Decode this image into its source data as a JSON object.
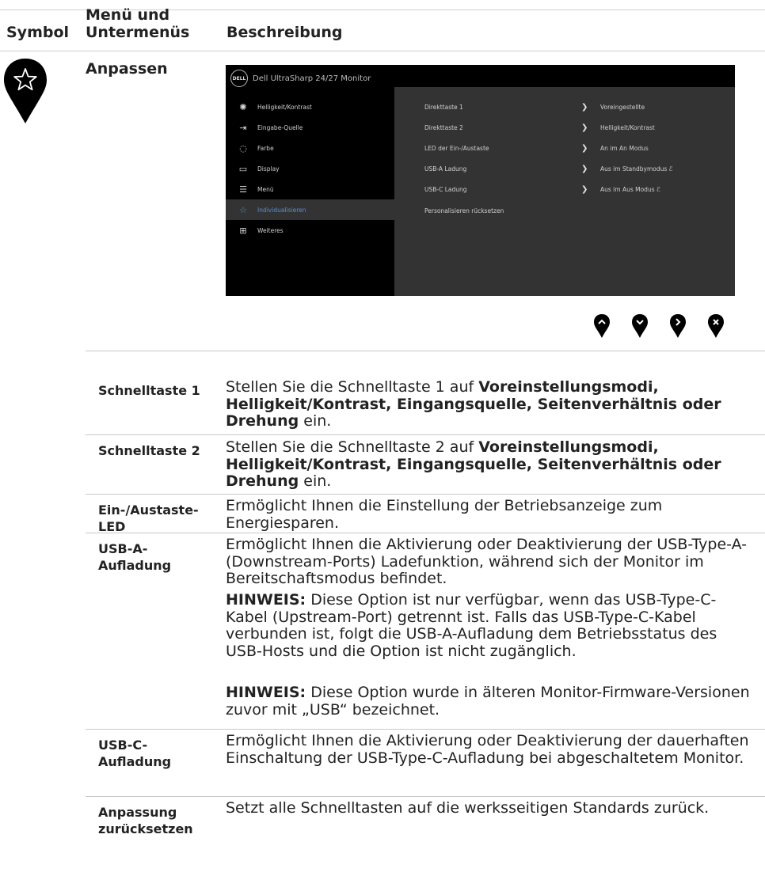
{
  "header": {
    "symbol": "Symbol",
    "menu": "Menü und Untermenüs",
    "description": "Beschreibung"
  },
  "section": {
    "title": "Anpassen",
    "icon": "star-icon"
  },
  "osd": {
    "title": "Dell UltraSharp 24/27 Monitor",
    "logo": "DELL",
    "menu": [
      {
        "label": "Helligkeit/Kontrast",
        "icon": "brightness-icon"
      },
      {
        "label": "Eingabe-Quelle",
        "icon": "input-source-icon"
      },
      {
        "label": "Farbe",
        "icon": "color-palette-icon"
      },
      {
        "label": "Display",
        "icon": "display-icon"
      },
      {
        "label": "Menü",
        "icon": "menu-icon"
      },
      {
        "label": "Individualisieren",
        "icon": "star-icon",
        "active": true
      },
      {
        "label": "Weiteres",
        "icon": "others-icon"
      }
    ],
    "submenu": [
      {
        "label": "Direkttaste 1",
        "value": "Voreingestellte"
      },
      {
        "label": "Direkttaste 2",
        "value": "Helligkeit/Kontrast"
      },
      {
        "label": "LED der Ein-/Austaste",
        "value": "An im An Modus"
      },
      {
        "label": "USB-A Ladung",
        "value": "Aus im Standbymodus"
      },
      {
        "label": "USB-C Ladung",
        "value": "Aus im Aus Modus"
      },
      {
        "label": "Personalisieren rücksetzen",
        "value": ""
      }
    ]
  },
  "nav_buttons": [
    "up-icon",
    "down-icon",
    "right-icon",
    "close-icon"
  ],
  "rows": [
    {
      "term": "Schnelltaste 1",
      "pre": "Stellen Sie die Schnelltaste 1 auf ",
      "bold": "Voreinstellungsmodi, Helligkeit/Kontrast, Eingangsquelle, Seitenverhältnis oder Drehung",
      "post": " ein."
    },
    {
      "term": "Schnelltaste 2",
      "pre": "Stellen Sie die Schnelltaste 2 auf ",
      "bold": "Voreinstellungsmodi, Helligkeit/Kontrast, Eingangsquelle, Seitenverhältnis oder Drehung",
      "post": " ein."
    },
    {
      "term_line1": "Ein-/Austaste-",
      "term_line2": "LED",
      "text": "Ermöglicht Ihnen die Einstellung der Betriebsanzeige zum Energiesparen."
    },
    {
      "term_line1": "USB-A-",
      "term_line2": "Aufladung",
      "text": "Ermöglicht Ihnen die Aktivierung oder Deaktivierung der USB-Type-A- (Downstream-Ports) Ladefunktion, während sich der Monitor im Bereitschaftsmodus befindet.",
      "note1_label": "HINWEIS:",
      "note1_text": " Diese Option ist nur verfügbar, wenn das USB-Type-C-Kabel (Upstream-Port) getrennt ist. Falls das USB-Type-C-Kabel verbunden ist, folgt die USB-A-Aufladung dem Betriebsstatus des USB-Hosts und die Option ist nicht zugänglich.",
      "note2_label": "HINWEIS:",
      "note2_text": " Diese Option wurde in älteren Monitor-Firmware-Versionen zuvor mit „USB“ bezeichnet."
    },
    {
      "term_line1": "USB-C-",
      "term_line2": "Aufladung",
      "text": "Ermöglicht Ihnen die Aktivierung oder Deaktivierung der dauerhaften Einschaltung der USB-Type-C-Aufladung bei abgeschaltetem Monitor."
    },
    {
      "term_line1": "Anpassung",
      "term_line2": "zurücksetzen",
      "text": "Setzt alle Schnelltasten auf die werksseitigen Standards zurück."
    }
  ]
}
